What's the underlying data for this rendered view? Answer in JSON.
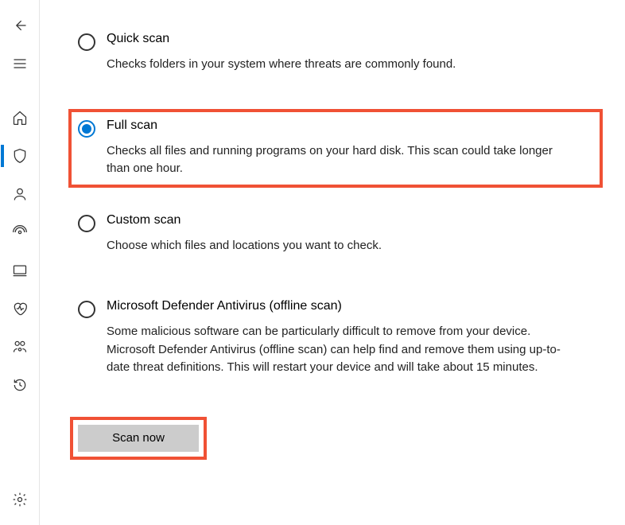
{
  "sidebar": {
    "items": [
      {
        "name": "back",
        "selected": false
      },
      {
        "name": "menu",
        "selected": false
      },
      {
        "name": "home",
        "selected": false
      },
      {
        "name": "shield",
        "selected": true
      },
      {
        "name": "account",
        "selected": false
      },
      {
        "name": "firewall",
        "selected": false
      },
      {
        "name": "device",
        "selected": false
      },
      {
        "name": "performance",
        "selected": false
      },
      {
        "name": "family",
        "selected": false
      },
      {
        "name": "history",
        "selected": false
      },
      {
        "name": "settings",
        "selected": false
      }
    ]
  },
  "options": [
    {
      "id": "quick",
      "title": "Quick scan",
      "description": "Checks folders in your system where threats are commonly found.",
      "checked": false,
      "highlight": false
    },
    {
      "id": "full",
      "title": "Full scan",
      "description": "Checks all files and running programs on your hard disk. This scan could take longer than one hour.",
      "checked": true,
      "highlight": true
    },
    {
      "id": "custom",
      "title": "Custom scan",
      "description": "Choose which files and locations you want to check.",
      "checked": false,
      "highlight": false
    },
    {
      "id": "offline",
      "title": "Microsoft Defender Antivirus (offline scan)",
      "description": "Some malicious software can be particularly difficult to remove from your device. Microsoft Defender Antivirus (offline scan) can help find and remove them using up-to-date threat definitions. This will restart your device and will take about 15 minutes.",
      "checked": false,
      "highlight": false
    }
  ],
  "scan_button": {
    "label": "Scan now",
    "highlight": true
  }
}
